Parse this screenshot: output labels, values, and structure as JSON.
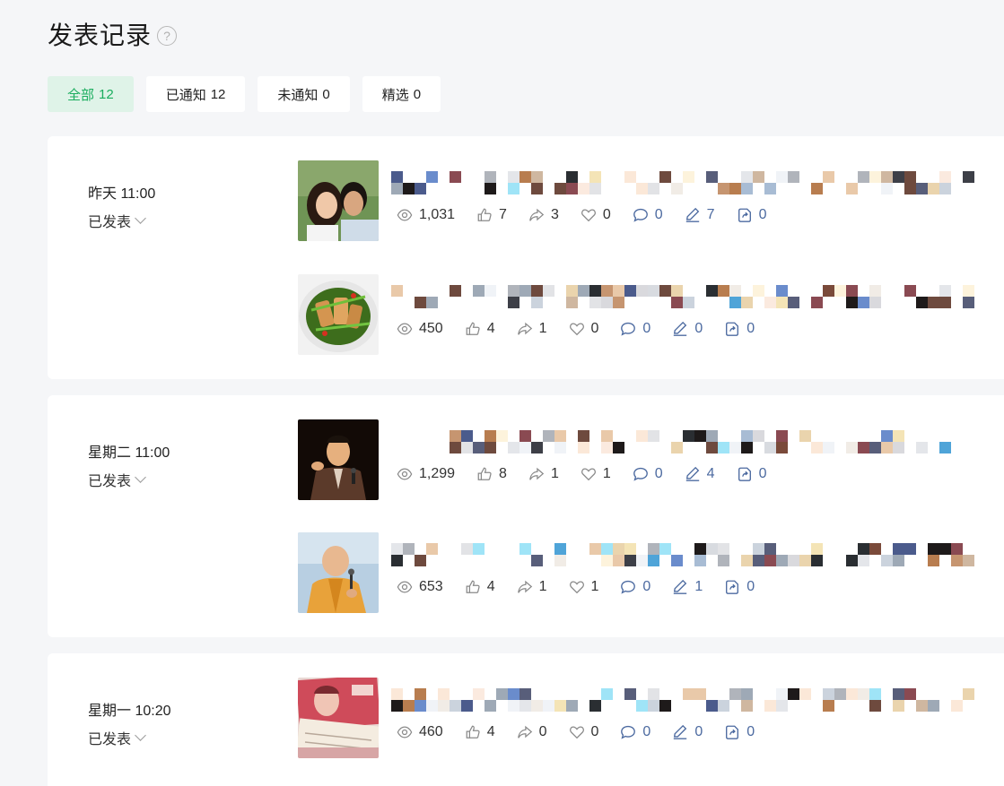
{
  "page": {
    "title": "发表记录",
    "help_icon": "?"
  },
  "tabs": [
    {
      "label": "全部",
      "count": "12",
      "active": true
    },
    {
      "label": "已通知",
      "count": "12",
      "active": false
    },
    {
      "label": "未通知",
      "count": "0",
      "active": false
    },
    {
      "label": "精选",
      "count": "0",
      "active": false
    }
  ],
  "groups": [
    {
      "time": "昨天 11:00",
      "status": "已发表",
      "posts": [
        {
          "thumb": "couple-photo",
          "stats": {
            "views": "1,031",
            "likes": "7",
            "shares": "3",
            "wows": "0",
            "comments": "0",
            "notes": "7",
            "forwards": "0"
          }
        },
        {
          "thumb": "food-dish",
          "stats": {
            "views": "450",
            "likes": "4",
            "shares": "1",
            "wows": "0",
            "comments": "0",
            "notes": "0",
            "forwards": "0"
          }
        }
      ]
    },
    {
      "time": "星期二 11:00",
      "status": "已发表",
      "posts": [
        {
          "thumb": "speaker-with-microphone",
          "stats": {
            "views": "1,299",
            "likes": "8",
            "shares": "1",
            "wows": "1",
            "comments": "0",
            "notes": "4",
            "forwards": "0"
          }
        },
        {
          "thumb": "monk-with-microphone",
          "stats": {
            "views": "653",
            "likes": "4",
            "shares": "1",
            "wows": "1",
            "comments": "0",
            "notes": "1",
            "forwards": "0"
          }
        }
      ]
    },
    {
      "time": "星期一 10:20",
      "status": "已发表",
      "posts": [
        {
          "thumb": "banknotes",
          "stats": {
            "views": "460",
            "likes": "4",
            "shares": "0",
            "wows": "0",
            "comments": "0",
            "notes": "0",
            "forwards": "0"
          }
        }
      ]
    }
  ],
  "icons": {
    "views": "eye-icon",
    "likes": "thumbs-up-icon",
    "shares": "share-arrow-icon",
    "wows": "heart-icon",
    "comments": "comment-icon",
    "notes": "pen-icon",
    "forwards": "forward-icon"
  },
  "colors": {
    "accent": "#1aad5e",
    "accent_bg": "#dff3e8",
    "link_blue": "#4c6aa0"
  }
}
